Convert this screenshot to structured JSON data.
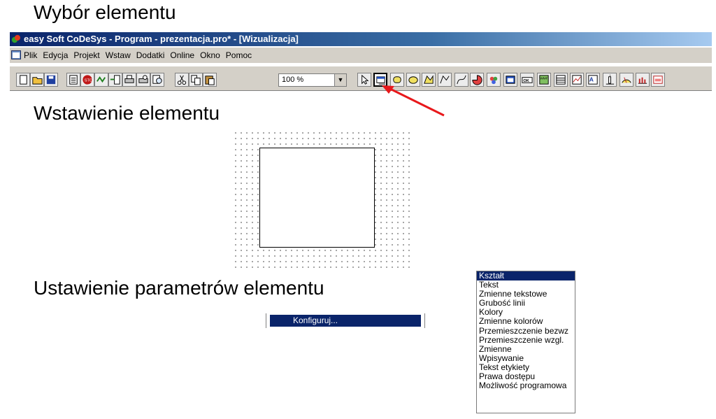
{
  "headings": {
    "select": "Wybór elementu",
    "insert": "Wstawienie elementu",
    "params": "Ustawienie parametrów elementu"
  },
  "window": {
    "title": "easy Soft CoDeSys - Program - prezentacja.pro* - [Wizualizacja]"
  },
  "menu": [
    "Plik",
    "Edycja",
    "Projekt",
    "Wstaw",
    "Dodatki",
    "Online",
    "Okno",
    "Pomoc"
  ],
  "toolbar": {
    "zoom": "100 %",
    "buttons": [
      "new-icon",
      "open-icon",
      "save-icon",
      "build-icon",
      "stop-icon",
      "run-icon",
      "step-icon",
      "print-icon",
      "print-preview-icon",
      "zoom-icon",
      "cut-icon",
      "copy-icon",
      "paste-icon"
    ],
    "tools": [
      "select-icon",
      "rectangle-icon",
      "rounded-rectangle-icon",
      "ellipse-icon",
      "polygon-icon",
      "polyline-icon",
      "curve-icon",
      "pie-icon",
      "bitmap-icon",
      "visualization-icon",
      "button-icon",
      "wmf-file-icon",
      "table-icon",
      "trend-icon",
      "alarm-table-icon",
      "bar-display-icon",
      "meter-icon",
      "histogram-icon",
      "activex-icon"
    ]
  },
  "context_menu": {
    "item": "Konfiguruj..."
  },
  "category_list": [
    "Kształt",
    "Tekst",
    "Zmienne tekstowe",
    "Grubość linii",
    "Kolory",
    "Zmienne kolorów",
    "Przemieszczenie bezwz",
    "Przemieszczenie wzgl.",
    "Zmienne",
    "Wpisywanie",
    "Tekst etykiety",
    "Prawa dostępu",
    "Możliwość programowa"
  ],
  "category_list_selected": "Kształt",
  "colors": {
    "title_bar": "#0a246a",
    "selection": "#0a246a",
    "pointer_arrow": "#e8181b"
  }
}
